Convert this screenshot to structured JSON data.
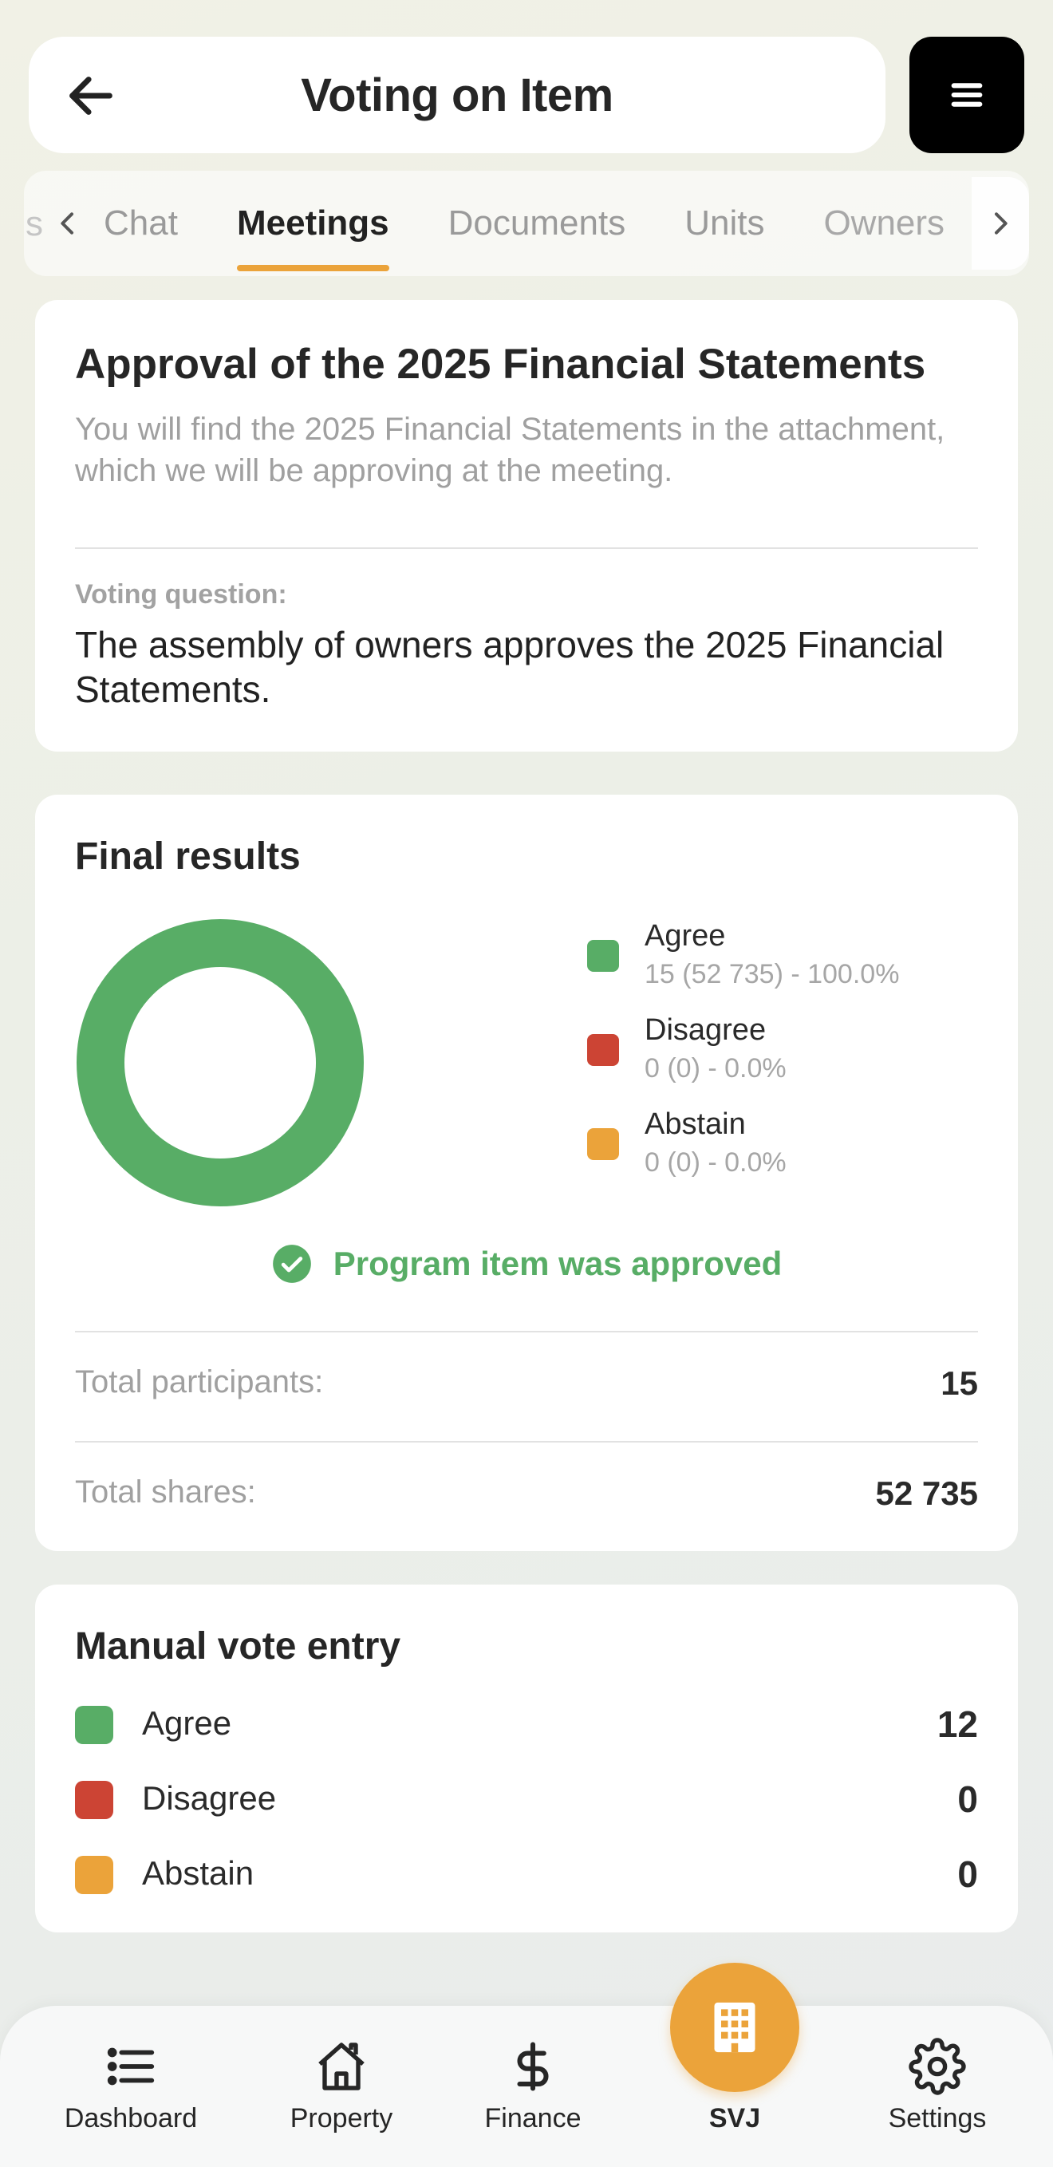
{
  "header": {
    "title": "Voting on Item"
  },
  "tabs": {
    "partial_left": "s",
    "items": [
      {
        "label": "Chat",
        "active": false
      },
      {
        "label": "Meetings",
        "active": true
      },
      {
        "label": "Documents",
        "active": false
      },
      {
        "label": "Units",
        "active": false
      },
      {
        "label": "Owners",
        "active": false
      }
    ]
  },
  "item": {
    "title": "Approval of the 2025 Financial Statements",
    "description": "You will find the 2025 Financial Statements in the attachment, which we will be approving at the meeting.",
    "voting_question_label": "Voting question:",
    "voting_question": "The assembly of owners approves the 2025 Financial Statements."
  },
  "results": {
    "title": "Final results",
    "legend": [
      {
        "name": "Agree",
        "value": "15 (52 735) - 100.0%",
        "color": "#58ad66",
        "share": 100.0
      },
      {
        "name": "Disagree",
        "value": "0 (0) - 0.0%",
        "color": "#cc4434",
        "share": 0.0
      },
      {
        "name": "Abstain",
        "value": "0 (0) - 0.0%",
        "color": "#eba33a",
        "share": 0.0
      }
    ],
    "status": "Program item was approved",
    "stats": [
      {
        "label": "Total participants:",
        "value": "15"
      },
      {
        "label": "Total shares:",
        "value": "52 735"
      }
    ]
  },
  "manual": {
    "title": "Manual vote entry",
    "rows": [
      {
        "name": "Agree",
        "count": "12",
        "color": "#58ad66"
      },
      {
        "name": "Disagree",
        "count": "0",
        "color": "#cc4434"
      },
      {
        "name": "Abstain",
        "count": "0",
        "color": "#eba33a"
      }
    ]
  },
  "nav": {
    "items": [
      {
        "label": "Dashboard",
        "icon": "list-icon"
      },
      {
        "label": "Property",
        "icon": "home-icon"
      },
      {
        "label": "Finance",
        "icon": "dollar-icon"
      },
      {
        "label": "SVJ",
        "icon": "building-icon"
      },
      {
        "label": "Settings",
        "icon": "gear-icon"
      }
    ]
  },
  "colors": {
    "accent": "#eba33a",
    "agree": "#58ad66",
    "disagree": "#cc4434",
    "abstain": "#eba33a"
  }
}
